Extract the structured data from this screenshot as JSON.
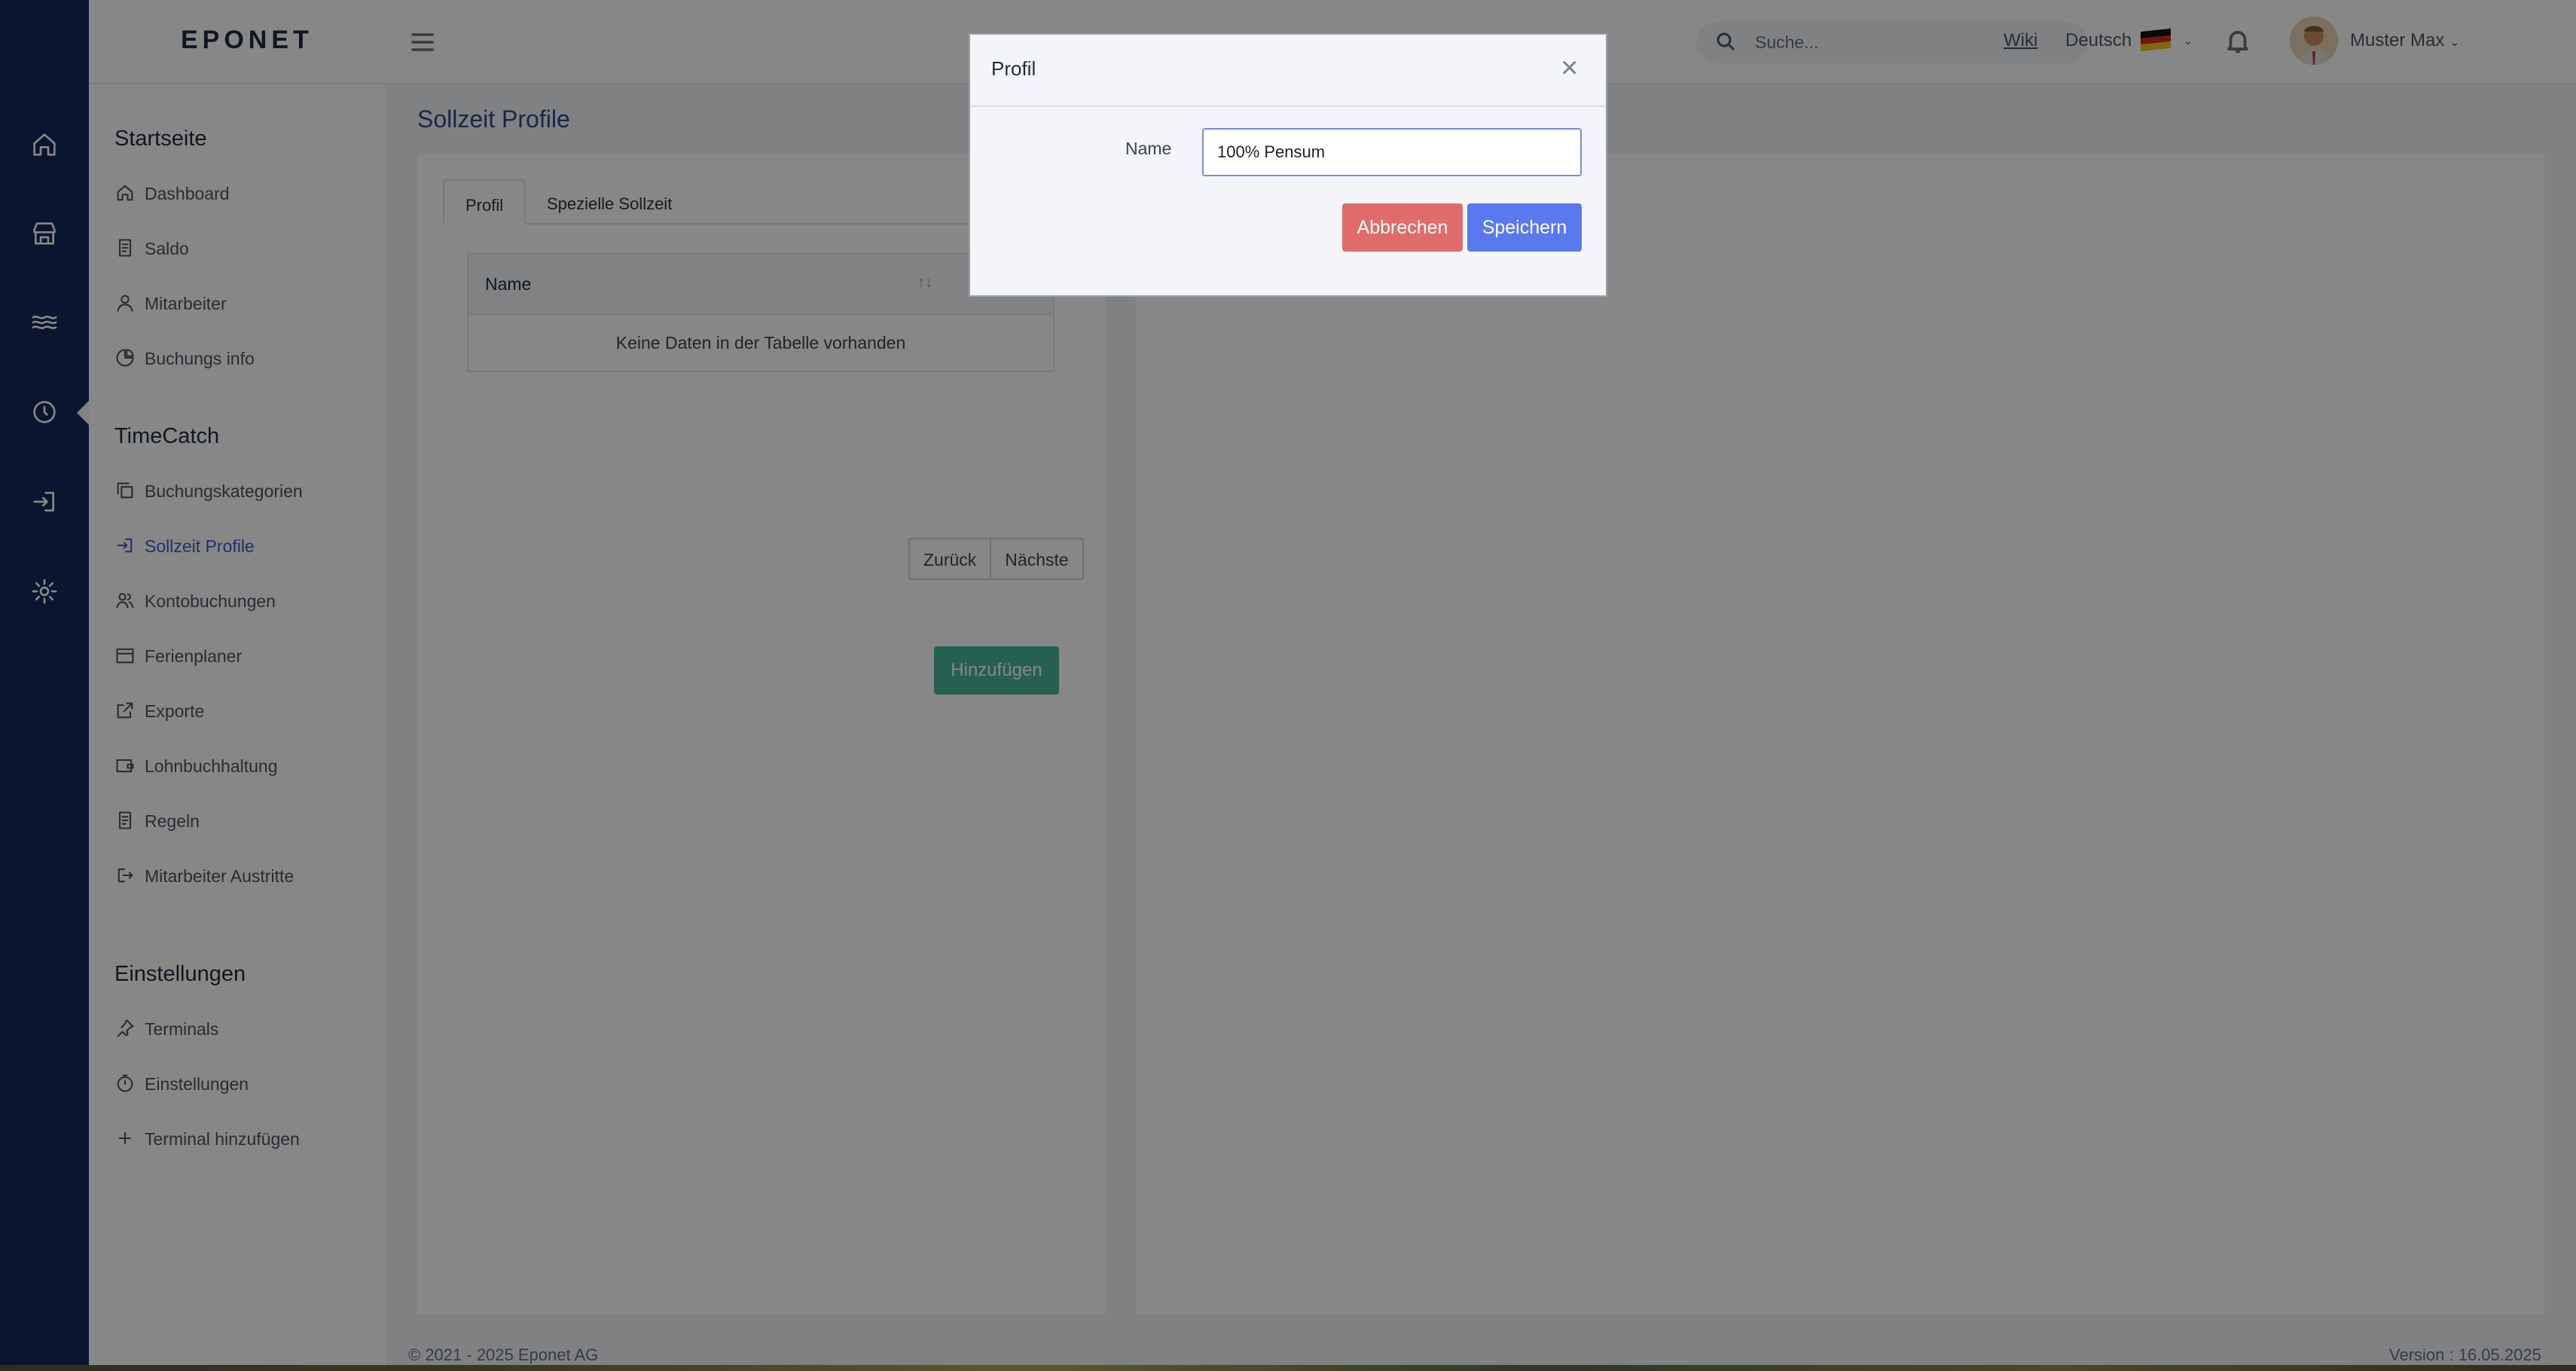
{
  "app": {
    "logo": "EPONET"
  },
  "topbar": {
    "search_placeholder": "Suche...",
    "wiki": "Wiki",
    "language": "Deutsch",
    "user_name": "Muster Max",
    "chevron": "⌄"
  },
  "sidebar": {
    "sections": [
      {
        "title": "Startseite",
        "items": [
          {
            "label": "Dashboard",
            "icon": "home-icon"
          },
          {
            "label": "Saldo",
            "icon": "document-icon"
          },
          {
            "label": "Mitarbeiter",
            "icon": "user-icon"
          },
          {
            "label": "Buchungs info",
            "icon": "pie-chart-icon"
          }
        ]
      },
      {
        "title": "TimeCatch",
        "items": [
          {
            "label": "Buchungskategorien",
            "icon": "copy-icon"
          },
          {
            "label": "Sollzeit Profile",
            "icon": "login-icon",
            "active": true
          },
          {
            "label": "Kontobuchungen",
            "icon": "users-icon"
          },
          {
            "label": "Ferienplaner",
            "icon": "calendar-icon"
          },
          {
            "label": "Exporte",
            "icon": "share-icon"
          },
          {
            "label": "Lohnbuchhaltung",
            "icon": "wallet-icon"
          },
          {
            "label": "Regeln",
            "icon": "document-icon"
          },
          {
            "label": "Mitarbeiter Austritte",
            "icon": "logout-icon"
          }
        ]
      },
      {
        "title": "Einstellungen",
        "items": [
          {
            "label": "Terminals",
            "icon": "pin-icon"
          },
          {
            "label": "Einstellungen",
            "icon": "timer-icon"
          },
          {
            "label": "Terminal hinzufügen",
            "icon": "plus-icon"
          }
        ]
      }
    ]
  },
  "main": {
    "title": "Sollzeit Profile",
    "tabs": [
      {
        "label": "Profil",
        "active": true
      },
      {
        "label": "Spezielle Sollzeit"
      }
    ],
    "table": {
      "columns": [
        "Name"
      ],
      "empty_text": "Keine Daten in der Tabelle vorhanden",
      "sort_icon": "↑↓"
    },
    "pagination": {
      "prev": "Zurück",
      "next": "Nächste"
    },
    "add_button": "Hinzufügen"
  },
  "footer": {
    "copyright": "© 2021 - 2025 Eponet AG",
    "version": "Version :  16.05.2025"
  },
  "modal": {
    "title": "Profil",
    "close": "×",
    "name_label": "Name",
    "name_value": "100% Pensum",
    "cancel": "Abbrechen",
    "save": "Speichern"
  },
  "colors": {
    "rail": "#142b5a",
    "active": "#3b5ccc",
    "cancel": "#e06b6b",
    "save": "#5b79ef",
    "add": "#47b59a"
  }
}
